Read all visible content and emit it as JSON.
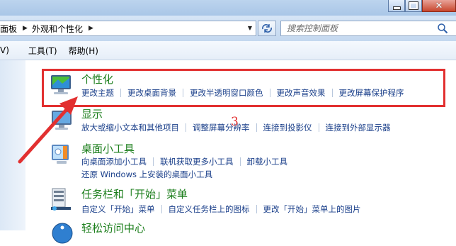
{
  "window": {
    "caption_buttons": [
      "minimize-icon",
      "maximize-icon",
      "close-icon"
    ]
  },
  "address": {
    "crumbs": [
      "面板",
      "外观和个性化"
    ],
    "search_placeholder": "搜索控制面板"
  },
  "menu": {
    "items": [
      "V)",
      "工具(T)",
      "帮助(H)"
    ]
  },
  "categories": [
    {
      "title": "个性化",
      "icon": "personalization-icon",
      "links": [
        "更改主题",
        "更改桌面背景",
        "更改半透明窗口颜色",
        "更改声音效果",
        "更改屏幕保护程序"
      ]
    },
    {
      "title": "显示",
      "icon": "display-icon",
      "links": [
        "放大或缩小文本和其他项目",
        "调整屏幕分辨率",
        "连接到投影仪",
        "连接到外部显示器"
      ]
    },
    {
      "title": "桌面小工具",
      "icon": "gadgets-icon",
      "links": [
        "向桌面添加小工具",
        "联机获取更多小工具",
        "卸载小工具"
      ],
      "links_line2": "还原 Windows 上安装的桌面小工具"
    },
    {
      "title": "任务栏和「开始」菜单",
      "icon": "taskbar-icon",
      "links": [
        "自定义「开始」菜单",
        "自定义任务栏上的图标",
        "更改「开始」菜单上的图片"
      ]
    },
    {
      "title": "轻松访问中心",
      "icon": "ease-of-access-icon"
    }
  ],
  "annotation": {
    "step_number": "3",
    "highlight_color": "#e23030"
  }
}
